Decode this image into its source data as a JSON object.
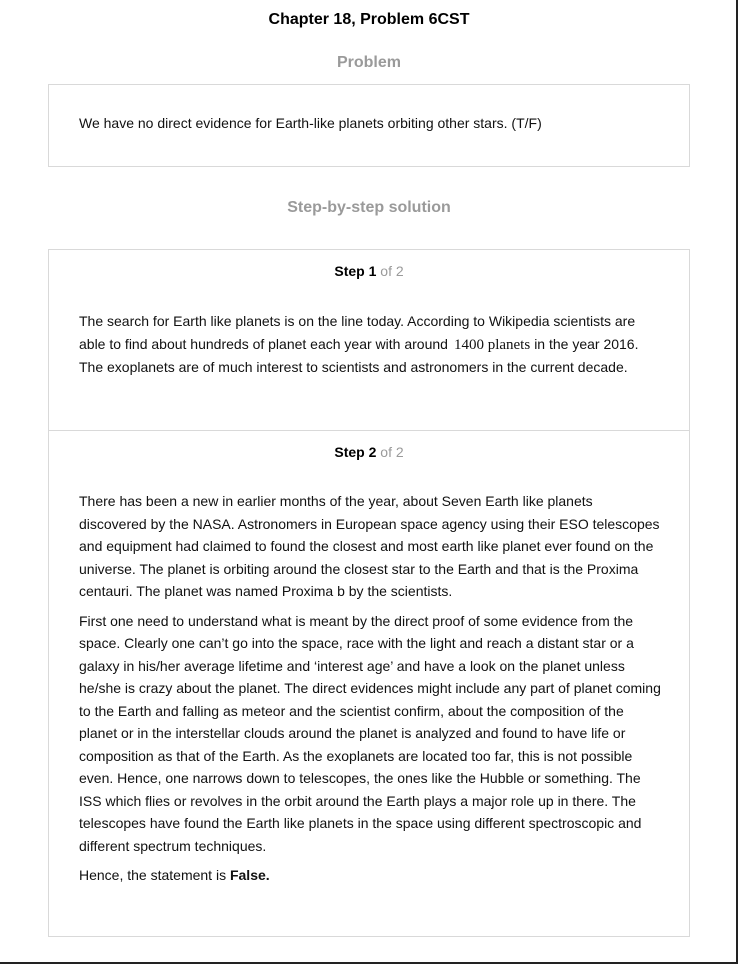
{
  "header": {
    "title": "Chapter 18, Problem 6CST"
  },
  "problem": {
    "heading": "Problem",
    "text": "We have no direct evidence for Earth-like planets orbiting other stars. (T/F)"
  },
  "solution": {
    "heading": "Step-by-step solution",
    "steps": [
      {
        "step_word": "Step",
        "number": "1",
        "of_text": "of 2",
        "text_before_math": "The search for Earth like planets is on the line today. According to Wikipedia scientists are able to find about hundreds of planet each year with around",
        "math": "1400 planets",
        "text_after_math": "in the year 2016. The exoplanets are of much interest to scientists and astronomers in the current decade."
      },
      {
        "step_word": "Step",
        "number": "2",
        "of_text": "of 2",
        "paragraphs": [
          "There has been a new in earlier months of the year, about Seven Earth like planets discovered by the NASA. Astronomers in European space agency using their ESO telescopes and equipment had claimed to found the closest and most earth like planet ever found on the universe. The planet is orbiting around the closest star to the Earth and that is the Proxima centauri. The planet was named Proxima b by the scientists.",
          "First one need to understand what is meant by the direct proof of some evidence from the space. Clearly one can’t go into the space, race with the light and reach a distant star or a galaxy in his/her average lifetime and ‘interest age’ and have a look on the planet unless he/she is crazy about the planet. The direct evidences might include any part of planet coming to the Earth and falling as meteor and the scientist confirm, about the composition of the planet or in the interstellar clouds around the planet is analyzed and found to have life or composition as that of the Earth. As the exoplanets are located too far, this is not possible even. Hence, one narrows down to telescopes, the ones like the Hubble or something. The ISS which flies or revolves in the orbit around the Earth plays a major role up in there. The telescopes have found the Earth like planets in the space using different spectroscopic and different spectrum techniques."
        ],
        "conclusion_prefix": "Hence, the statement is",
        "conclusion_answer": "False."
      }
    ]
  }
}
